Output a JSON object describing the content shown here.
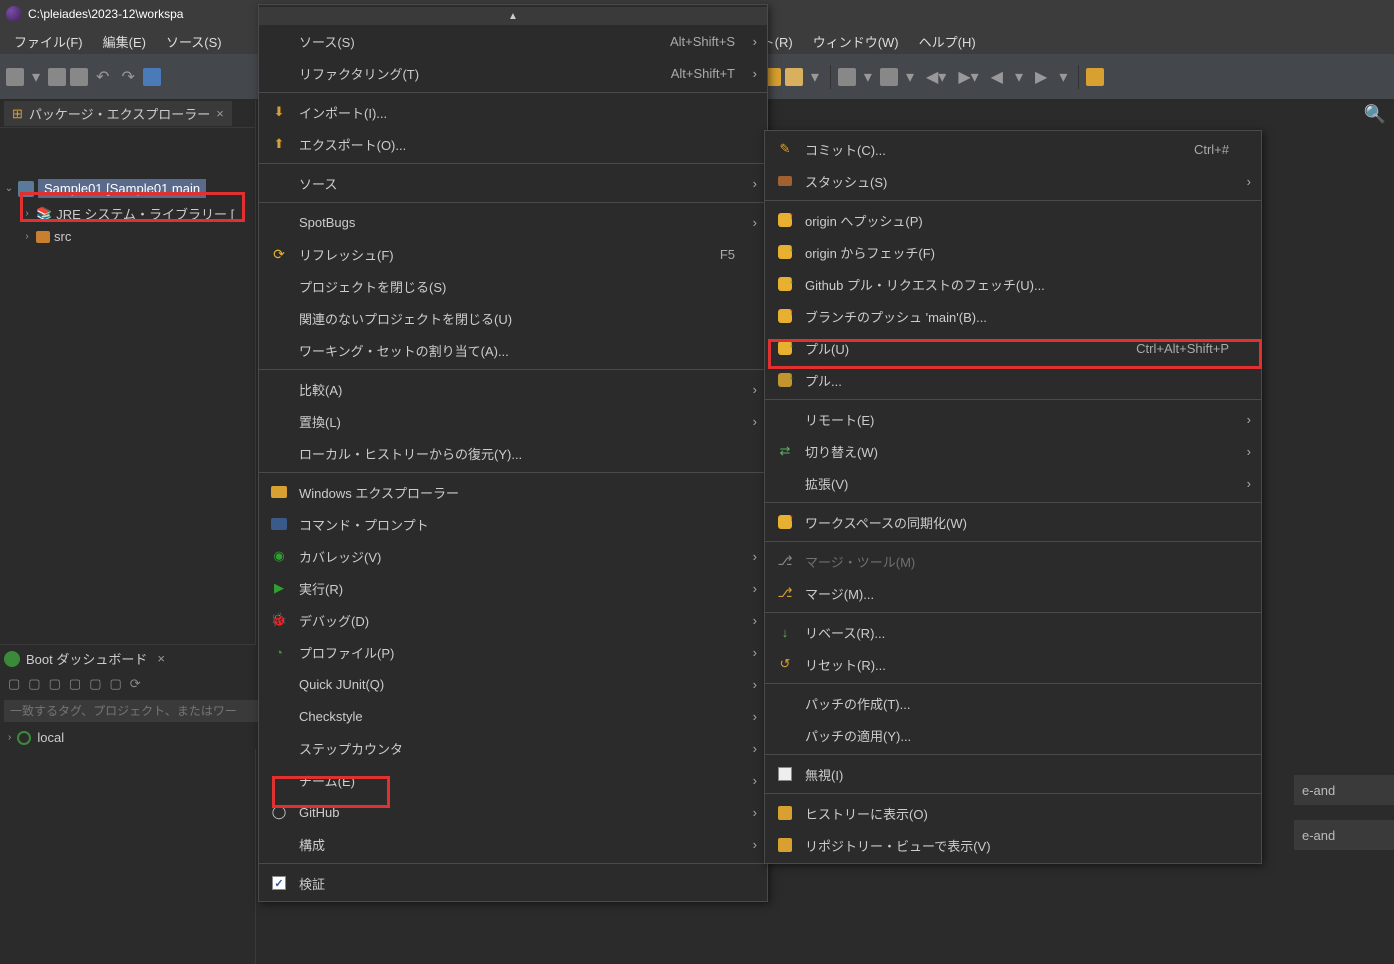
{
  "titlebar": {
    "path": "C:\\pleiades\\2023-12\\workspa"
  },
  "menubar": [
    {
      "label": "ファイル(F)"
    },
    {
      "label": "編集(E)"
    },
    {
      "label": "ソース(S)"
    },
    {
      "label": "ト(R)"
    },
    {
      "label": "ウィンドウ(W)"
    },
    {
      "label": "ヘルプ(H)"
    }
  ],
  "package_explorer": {
    "tab_label": "パッケージ・エクスプローラー",
    "project": "Sample01 [Sample01 main",
    "jre": "JRE システム・ライブラリー [",
    "src": "src"
  },
  "boot_dashboard": {
    "tab_label": "Boot ダッシュボード",
    "filter_placeholder": "一致するタグ、プロジェクト、またはワー",
    "local_label": "local"
  },
  "context_menu": [
    {
      "type": "top_arrow"
    },
    {
      "label": "ソース(S)",
      "shortcut": "Alt+Shift+S",
      "arrow": true
    },
    {
      "label": "リファクタリング(T)",
      "shortcut": "Alt+Shift+T",
      "arrow": true
    },
    {
      "type": "sep"
    },
    {
      "label": "インポート(I)...",
      "icon": "import"
    },
    {
      "label": "エクスポート(O)...",
      "icon": "export"
    },
    {
      "type": "sep"
    },
    {
      "label": "ソース",
      "arrow": true
    },
    {
      "type": "sep"
    },
    {
      "label": "SpotBugs",
      "arrow": true
    },
    {
      "label": "リフレッシュ(F)",
      "shortcut": "F5",
      "icon": "refresh"
    },
    {
      "label": "プロジェクトを閉じる(S)"
    },
    {
      "label": "関連のないプロジェクトを閉じる(U)"
    },
    {
      "label": "ワーキング・セットの割り当て(A)..."
    },
    {
      "type": "sep"
    },
    {
      "label": "比較(A)",
      "arrow": true
    },
    {
      "label": "置換(L)",
      "arrow": true
    },
    {
      "label": "ローカル・ヒストリーからの復元(Y)..."
    },
    {
      "type": "sep"
    },
    {
      "label": "Windows エクスプローラー",
      "icon": "folder-search"
    },
    {
      "label": "コマンド・プロンプト",
      "icon": "terminal"
    },
    {
      "label": "カバレッジ(V)",
      "icon": "coverage",
      "arrow": true
    },
    {
      "label": "実行(R)",
      "icon": "run",
      "arrow": true
    },
    {
      "label": "デバッグ(D)",
      "icon": "debug",
      "arrow": true
    },
    {
      "label": "プロファイル(P)",
      "icon": "profile",
      "arrow": true
    },
    {
      "label": "Quick JUnit(Q)",
      "arrow": true
    },
    {
      "label": "Checkstyle",
      "arrow": true
    },
    {
      "label": "ステップカウンタ",
      "arrow": true
    },
    {
      "label": "チーム(E)",
      "arrow": true,
      "highlight": true
    },
    {
      "label": "GitHub",
      "icon": "github",
      "arrow": true
    },
    {
      "label": "構成",
      "arrow": true
    },
    {
      "type": "sep"
    },
    {
      "label": "検証",
      "icon": "checkbox"
    }
  ],
  "team_submenu": [
    {
      "label": "コミット(C)...",
      "icon": "commit",
      "shortcut": "Ctrl+#"
    },
    {
      "label": "スタッシュ(S)",
      "icon": "stash",
      "arrow": true
    },
    {
      "type": "sep"
    },
    {
      "label": "origin へプッシュ(P)",
      "icon": "push"
    },
    {
      "label": "origin からフェッチ(F)",
      "icon": "pull"
    },
    {
      "label": "Github プル・リクエストのフェッチ(U)...",
      "icon": "pull"
    },
    {
      "label": "ブランチのプッシュ 'main'(B)...",
      "icon": "push"
    },
    {
      "label": "プル(U)",
      "icon": "pull",
      "shortcut": "Ctrl+Alt+Shift+P",
      "highlight": true
    },
    {
      "label": "プル...",
      "icon": "pull-cfg"
    },
    {
      "type": "sep"
    },
    {
      "label": "リモート(E)",
      "arrow": true
    },
    {
      "label": "切り替え(W)",
      "icon": "switch",
      "arrow": true
    },
    {
      "label": "拡張(V)",
      "arrow": true
    },
    {
      "type": "sep"
    },
    {
      "label": "ワークスペースの同期化(W)",
      "icon": "sync"
    },
    {
      "type": "sep"
    },
    {
      "label": "マージ・ツール(M)",
      "icon": "merge-tool",
      "disabled": true
    },
    {
      "label": "マージ(M)...",
      "icon": "merge"
    },
    {
      "type": "sep"
    },
    {
      "label": "リベース(R)...",
      "icon": "rebase"
    },
    {
      "label": "リセット(R)...",
      "icon": "reset"
    },
    {
      "type": "sep"
    },
    {
      "label": "パッチの作成(T)..."
    },
    {
      "label": "パッチの適用(Y)..."
    },
    {
      "type": "sep"
    },
    {
      "label": "無視(I)",
      "icon": "ignore"
    },
    {
      "type": "sep"
    },
    {
      "label": "ヒストリーに表示(O)",
      "icon": "history"
    },
    {
      "label": "リポジトリー・ビューで表示(V)",
      "icon": "repo"
    }
  ],
  "editor_rows": [
    {
      "text": "e-and"
    },
    {
      "text": "e-and"
    }
  ]
}
